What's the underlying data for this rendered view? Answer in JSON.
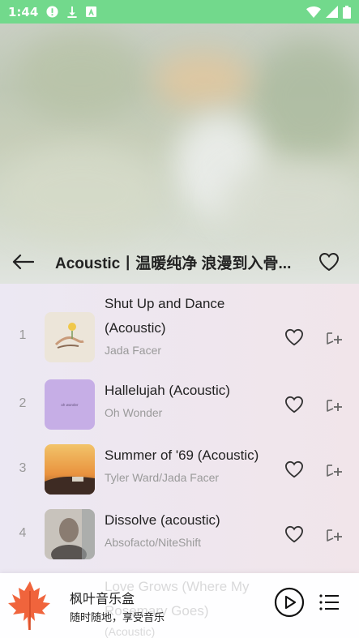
{
  "status_bar": {
    "time": "1:44"
  },
  "header": {
    "title": "Acoustic丨温暖纯净 浪漫到入骨..."
  },
  "songs": [
    {
      "index": "1",
      "title": "Shut Up and Dance (Acoustic)",
      "artist": "Jada Facer",
      "cover_color": "#e9e2d6"
    },
    {
      "index": "2",
      "title": "Hallelujah (Acoustic)",
      "artist": "Oh Wonder",
      "cover_color": "#c6aee6"
    },
    {
      "index": "3",
      "title": "Summer of '69 (Acoustic)",
      "artist": "Tyler Ward/Jada Facer",
      "cover_color": "#e9a850"
    },
    {
      "index": "4",
      "title": "Dissolve (acoustic)",
      "artist": "Absofacto/NiteShift",
      "cover_color": "#c8c3bc"
    }
  ],
  "partial_song": {
    "title": "Love Grows (Where My",
    "subtitle": "Rosemary Goes)",
    "artist": "(Acoustic)"
  },
  "player": {
    "name": "枫叶音乐盒",
    "subtitle": "随时随地，享受音乐",
    "logo_color": "#f0643c"
  },
  "colors": {
    "status_bar": "#72d98c",
    "accent": "#222222"
  }
}
